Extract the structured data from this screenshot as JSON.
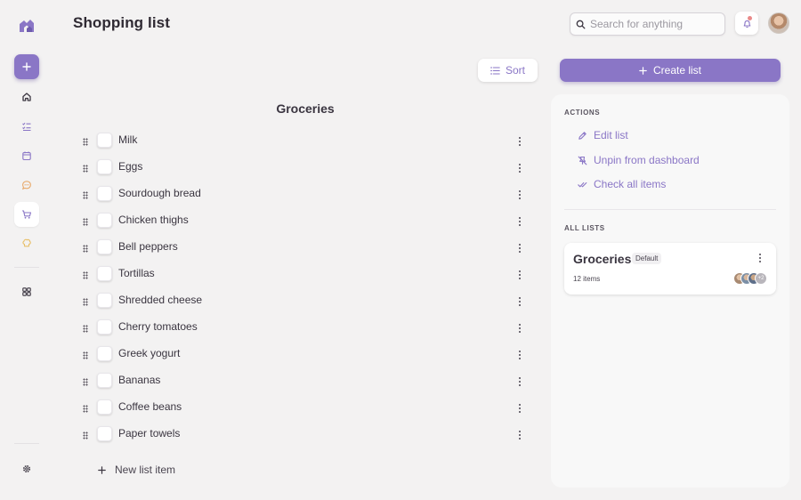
{
  "header": {
    "title": "Shopping list",
    "search_placeholder": "Search for anything"
  },
  "sidebar": {
    "items": [
      {
        "name": "home-icon"
      },
      {
        "name": "tasks-icon"
      },
      {
        "name": "calendar-icon"
      },
      {
        "name": "chat-icon"
      },
      {
        "name": "cart-icon",
        "active": true
      },
      {
        "name": "chef-hat-icon"
      },
      {
        "name": "grid-icon"
      }
    ]
  },
  "toolbar": {
    "sort_label": "Sort",
    "create_label": "Create list"
  },
  "list": {
    "title": "Groceries",
    "items": [
      "Milk",
      "Eggs",
      "Sourdough bread",
      "Chicken thighs",
      "Bell peppers",
      "Tortillas",
      "Shredded cheese",
      "Cherry tomatoes",
      "Greek yogurt",
      "Bananas",
      "Coffee beans",
      "Paper towels"
    ],
    "new_item_label": "New list item"
  },
  "panel": {
    "actions_title": "ACTIONS",
    "actions": {
      "edit": "Edit list",
      "unpin": "Unpin from dashboard",
      "check_all": "Check all items"
    },
    "all_lists_title": "ALL LISTS",
    "card": {
      "title": "Groceries",
      "badge": "Default",
      "count": "12 items",
      "more_members": "+2"
    }
  },
  "colors": {
    "accent": "#8a76c6",
    "background": "#f3f2f2"
  }
}
